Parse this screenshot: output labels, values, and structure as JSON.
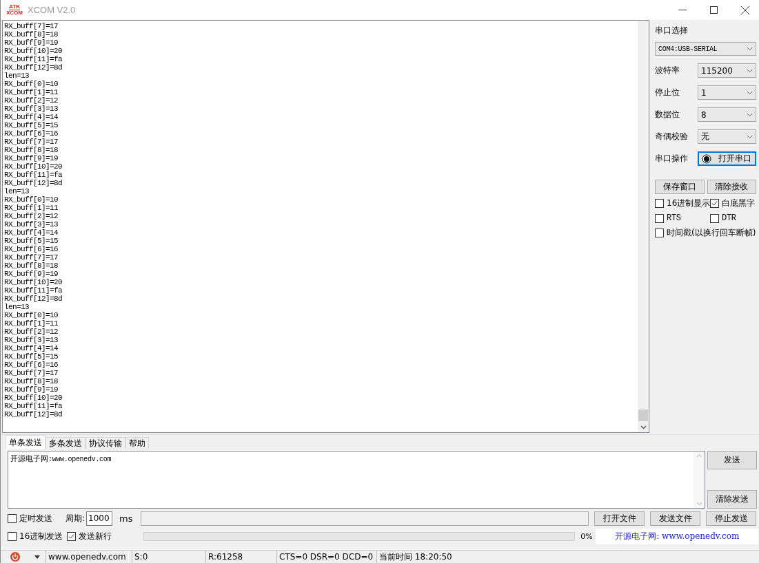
{
  "window": {
    "title": "XCOM V2.0",
    "logo_lines": [
      "ATK",
      "XCOM"
    ]
  },
  "receive": {
    "lines": [
      "RX_buff[7]=17",
      "RX_buff[8]=18",
      "RX_buff[9]=19",
      "RX_buff[10]=20",
      "RX_buff[11]=fa",
      "RX_buff[12]=8d",
      "len=13",
      "RX_buff[0]=10",
      "RX_buff[1]=11",
      "RX_buff[2]=12",
      "RX_buff[3]=13",
      "RX_buff[4]=14",
      "RX_buff[5]=15",
      "RX_buff[6]=16",
      "RX_buff[7]=17",
      "RX_buff[8]=18",
      "RX_buff[9]=19",
      "RX_buff[10]=20",
      "RX_buff[11]=fa",
      "RX_buff[12]=8d",
      "len=13",
      "RX_buff[0]=10",
      "RX_buff[1]=11",
      "RX_buff[2]=12",
      "RX_buff[3]=13",
      "RX_buff[4]=14",
      "RX_buff[5]=15",
      "RX_buff[6]=16",
      "RX_buff[7]=17",
      "RX_buff[8]=18",
      "RX_buff[9]=19",
      "RX_buff[10]=20",
      "RX_buff[11]=fa",
      "RX_buff[12]=8d",
      "len=13",
      "RX_buff[0]=10",
      "RX_buff[1]=11",
      "RX_buff[2]=12",
      "RX_buff[3]=13",
      "RX_buff[4]=14",
      "RX_buff[5]=15",
      "RX_buff[6]=16",
      "RX_buff[7]=17",
      "RX_buff[8]=18",
      "RX_buff[9]=19",
      "RX_buff[10]=20",
      "RX_buff[11]=fa",
      "RX_buff[12]=8d"
    ]
  },
  "sidebar": {
    "port_title": "串口选择",
    "port_value": "COM4:USB-SERIAL",
    "settings": [
      {
        "label": "波特率",
        "value": "115200"
      },
      {
        "label": "停止位",
        "value": "1"
      },
      {
        "label": "数据位",
        "value": "8"
      },
      {
        "label": "奇偶校验",
        "value": "无"
      }
    ],
    "operation_label": "串口操作",
    "open_button": "打开串口",
    "buttons": [
      "保存窗口",
      "清除接收"
    ],
    "checks": [
      {
        "label": "16进制显示",
        "checked": false
      },
      {
        "label": "白底黑字",
        "checked": true
      },
      {
        "label": "RTS",
        "checked": false
      },
      {
        "label": "DTR",
        "checked": false
      },
      {
        "label": "时间戳(以换行回车断帧)",
        "checked": false
      }
    ]
  },
  "tabs": [
    {
      "label": "单条发送",
      "selected": true
    },
    {
      "label": "多条发送",
      "selected": false
    },
    {
      "label": "协议传输",
      "selected": false
    },
    {
      "label": "帮助",
      "selected": false
    }
  ],
  "send": {
    "text_cjk": "开源电子网",
    "text_rest": ":www.openedv.com",
    "send_button": "发送",
    "clear_button": "清除发送"
  },
  "options": {
    "timed": {
      "label": "定时发送",
      "checked": false
    },
    "period_label": "周期:",
    "period_value": "1000",
    "unit": "ms",
    "hex": {
      "label": "16进制发送",
      "checked": false
    },
    "newline": {
      "label": "发送新行",
      "checked": true
    },
    "file_buttons": [
      "打开文件",
      "发送文件",
      "停止发送"
    ],
    "progress": {
      "level": 0,
      "reading": "0%"
    },
    "banner": "开源电子网: www.openedv.com"
  },
  "status_bar": [
    "www.openedv.com",
    "S:0",
    "R:61258",
    "CTS=0 DSR=0 DCD=0",
    "当前时间 18:20:50"
  ]
}
